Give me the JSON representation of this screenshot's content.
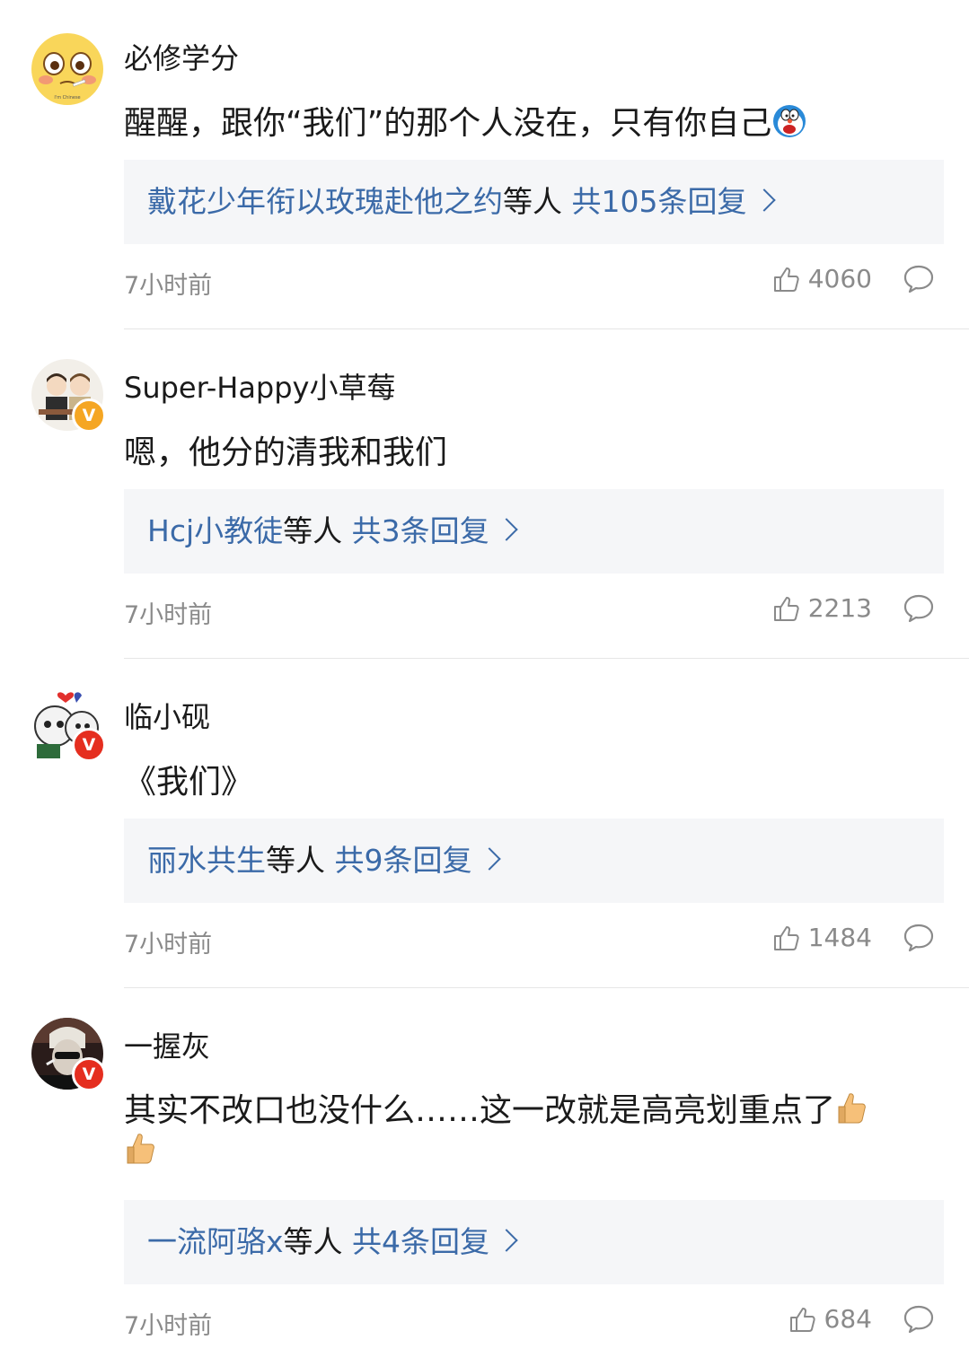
{
  "comments": [
    {
      "username": "必修学分",
      "text": "醒醒，跟你“我们”的那个人没在，只有你自己",
      "reply_names": "戴花少年衔以玫瑰赴他之约",
      "reply_mid": "等人 ",
      "reply_count": "共105条回复",
      "time": "7小时前",
      "likes": "4060",
      "avatar_text": "I'm Chinese"
    },
    {
      "username": "Super-Happy小草莓",
      "text": "嗯，他分的清我和我们",
      "reply_names": "Hcj小教徒",
      "reply_mid": "等人 ",
      "reply_count": "共3条回复",
      "time": "7小时前",
      "likes": "2213",
      "badge": "V",
      "badge_color": "#f5a623"
    },
    {
      "username": "临小砚",
      "text": "《我们》",
      "reply_names": "丽水共生",
      "reply_mid": "等人 ",
      "reply_count": "共9条回复",
      "time": "7小时前",
      "likes": "1484",
      "badge": "V",
      "badge_color": "#e52e1f"
    },
    {
      "username": "一握灰",
      "text_line1": "其实不改口也没什么……这一改就是高亮划重点了",
      "reply_names": "一流阿骆x",
      "reply_mid": "等人 ",
      "reply_count": "共4条回复",
      "time": "7小时前",
      "likes": "684",
      "badge": "V",
      "badge_color": "#e52e1f"
    }
  ],
  "colors": {
    "link": "#3b6aa8",
    "text": "#1a1a1a",
    "meta": "#8a8a8a",
    "reply_bg": "#f5f6f8"
  }
}
